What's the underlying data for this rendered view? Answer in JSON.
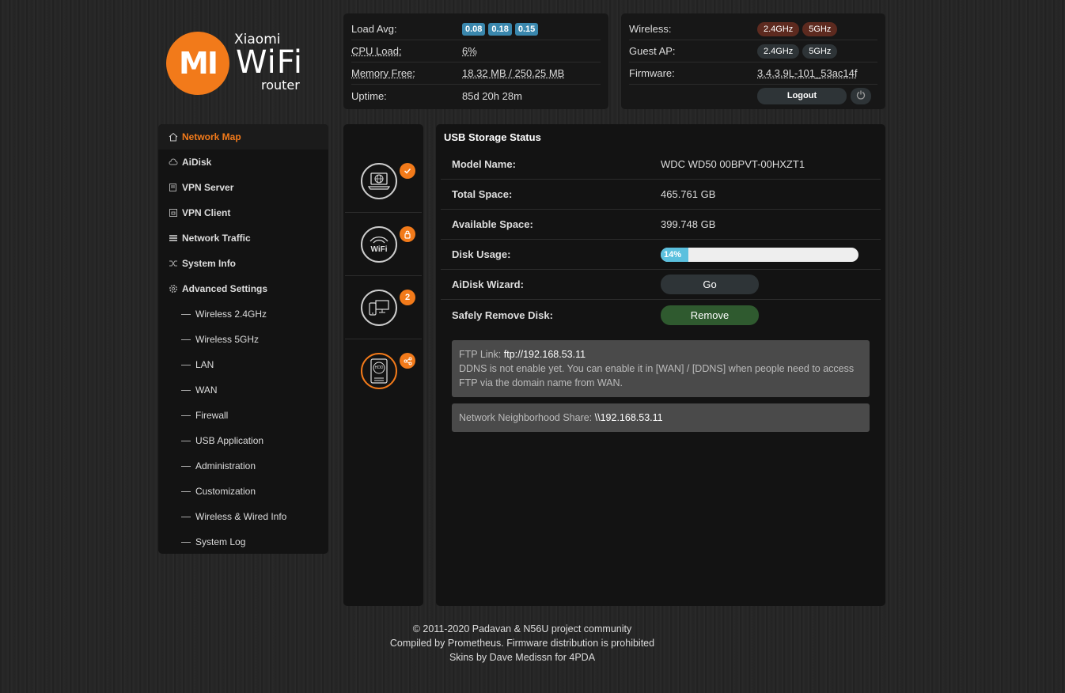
{
  "logo": {
    "mi": "MI",
    "top": "Xiaomi",
    "mid": "WiFi",
    "bot": "router"
  },
  "status_left": {
    "load_avg_label": "Load Avg:",
    "load_avg": [
      "0.08",
      "0.18",
      "0.15"
    ],
    "cpu_label": "CPU Load:",
    "cpu_value": "6%",
    "mem_label": "Memory Free:",
    "mem_value": "18.32 MB / 250.25 MB",
    "uptime_label": "Uptime:",
    "uptime_value": "85d 20h 28m"
  },
  "status_right": {
    "wireless_label": "Wireless:",
    "guest_label": "Guest AP:",
    "band_24": "2.4GHz",
    "band_5": "5GHz",
    "firmware_label": "Firmware:",
    "firmware_value": "3.4.3.9L-101_53ac14f",
    "logout": "Logout"
  },
  "nav": {
    "items": [
      {
        "label": "Network Map",
        "icon": "home-icon"
      },
      {
        "label": "AiDisk",
        "icon": "cloud-icon"
      },
      {
        "label": "VPN Server",
        "icon": "vpn-server-icon"
      },
      {
        "label": "VPN Client",
        "icon": "vpn-client-icon"
      },
      {
        "label": "Network Traffic",
        "icon": "traffic-icon"
      },
      {
        "label": "System Info",
        "icon": "shuffle-icon"
      },
      {
        "label": "Advanced Settings",
        "icon": "gear-icon"
      }
    ],
    "sub": [
      "Wireless 2.4GHz",
      "Wireless 5GHz",
      "LAN",
      "WAN",
      "Firewall",
      "USB Application",
      "Administration",
      "Customization",
      "Wireless & Wired Info",
      "System Log"
    ]
  },
  "iconcol": {
    "wifi_text": "WiFi",
    "hdd_text": "HDD",
    "clients_badge": "2"
  },
  "main": {
    "title": "USB Storage Status",
    "model_label": "Model Name:",
    "model_value": "WDC WD50 00BPVT-00HXZT1",
    "total_label": "Total Space:",
    "total_value": "465.761 GB",
    "avail_label": "Available Space:",
    "avail_value": "399.748 GB",
    "usage_label": "Disk Usage:",
    "usage_value": "14%",
    "usage_fraction": 0.14,
    "wizard_label": "AiDisk Wizard:",
    "go": "Go",
    "remove_label": "Safely Remove Disk:",
    "remove": "Remove",
    "ftp_prefix": "FTP Link:",
    "ftp_link": "ftp://192.168.53.11",
    "ddns_text": "DDNS is not enable yet. You can enable it in [WAN] / [DDNS] when people need to access FTP via the domain name from WAN.",
    "share_prefix": "Network Neighborhood Share:",
    "share_link": "\\\\192.168.53.11"
  },
  "footer": {
    "line1": "© 2011-2020 Padavan & N56U project community",
    "line2": "Compiled by Prometheus. Firmware distribution is prohibited",
    "line3": "Skins by Dave Medissn for 4PDA"
  },
  "colors": {
    "accent": "#f27a1a",
    "badge_blue": "#3a87ad",
    "remove_green": "#2f5a2f"
  }
}
